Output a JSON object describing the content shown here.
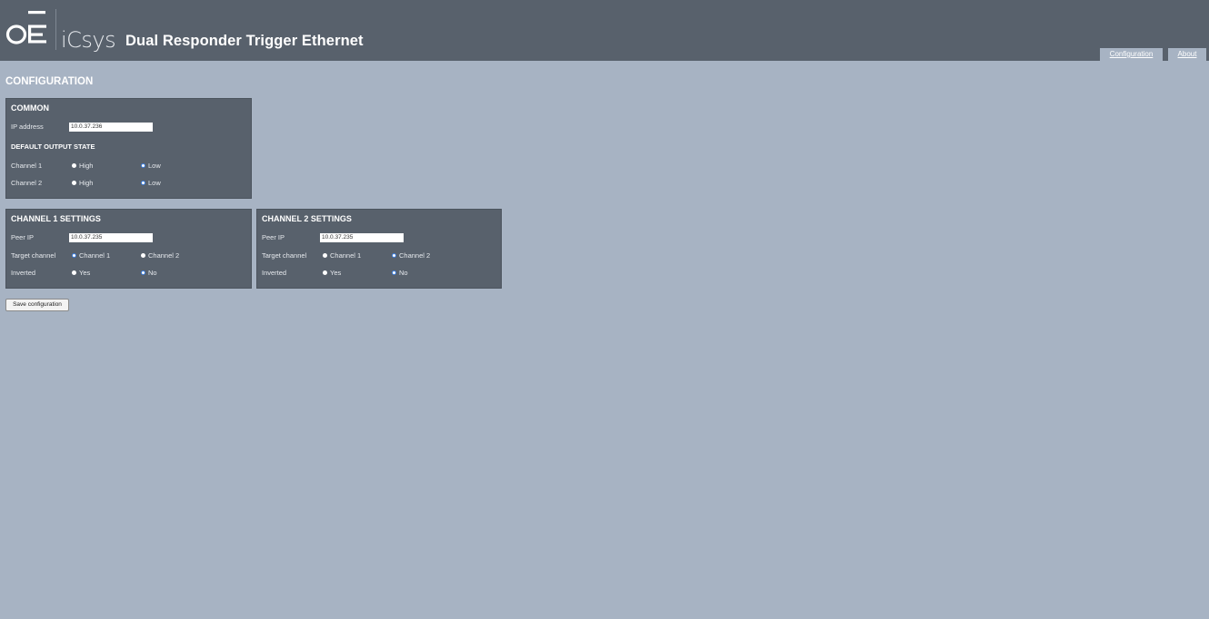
{
  "header": {
    "logo_text": "iCsys",
    "app_title": "Dual Responder Trigger Ethernet",
    "tabs": [
      {
        "label": "Configuration"
      },
      {
        "label": "About"
      }
    ]
  },
  "page_title": "CONFIGURATION",
  "common": {
    "heading": "COMMON",
    "ip_label": "IP address",
    "ip_value": "10.0.37.236",
    "default_output_heading": "DEFAULT OUTPUT STATE",
    "channel1_label": "Channel 1",
    "channel2_label": "Channel 2",
    "high_label": "High",
    "low_label": "Low",
    "channel1_selected": "Low",
    "channel2_selected": "Low"
  },
  "channel1": {
    "heading": "CHANNEL 1 SETTINGS",
    "peer_ip_label": "Peer IP",
    "peer_ip_value": "10.0.37.235",
    "target_label": "Target channel",
    "target_option1": "Channel 1",
    "target_option2": "Channel 2",
    "target_selected": "Channel 1",
    "inverted_label": "Inverted",
    "yes_label": "Yes",
    "no_label": "No",
    "inverted_selected": "No"
  },
  "channel2": {
    "heading": "CHANNEL 2 SETTINGS",
    "peer_ip_label": "Peer IP",
    "peer_ip_value": "10.0.37.235",
    "target_label": "Target channel",
    "target_option1": "Channel 1",
    "target_option2": "Channel 2",
    "target_selected": "Channel 2",
    "inverted_label": "Inverted",
    "yes_label": "Yes",
    "no_label": "No",
    "inverted_selected": "No"
  },
  "save_label": "Save configuration",
  "colors": {
    "header_bg": "#58616c",
    "page_bg": "#a7b3c3",
    "panel_bg": "#58616c",
    "radio_checked": "#3b7ddd"
  }
}
